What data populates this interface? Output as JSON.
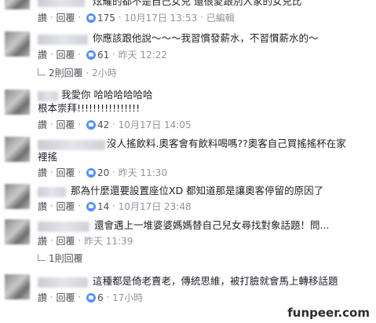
{
  "comments": [
    {
      "text": "炫耀的都不是自己女兒 還很愛跟別人家的女兒比",
      "like_label": "讚",
      "reply_label": "回覆",
      "likes": "175",
      "time": "10月17日 13:53",
      "edited": "已編輯"
    },
    {
      "text": "你應該跟他說～～～我習慣發薪水，不習慣薪水的～",
      "like_label": "讚",
      "reply_label": "回覆",
      "likes": "61",
      "time": "昨天 12:22",
      "replies": "2則回覆",
      "replies_time": "2小時"
    },
    {
      "text": "我愛你 哈哈哈哈哈哈",
      "text2": "根本崇拜!!!!!!!!!!!!!!!!",
      "like_label": "讚",
      "reply_label": "回覆",
      "likes": "42",
      "time": "10月17日 14:05"
    },
    {
      "text": "沒人搖飲料.奧客會有飲料喝嗎??奧客自己買搖搖杯在家",
      "text2": "裡搖",
      "like_label": "讚",
      "reply_label": "回覆",
      "likes": "20",
      "time": "昨天 11:30"
    },
    {
      "text": "那為什麼還要設置座位XD 都知道那是讓奧客停留的原因了",
      "like_label": "讚",
      "reply_label": "回覆",
      "likes": "14",
      "time": "10月17日 23:48"
    },
    {
      "text": "還會遇上一堆婆婆媽媽替自己兒女尋找對象話題！問...",
      "like_label": "讚",
      "reply_label": "回覆",
      "time": "昨天 11:39",
      "replies": "1則回覆"
    },
    {
      "text": "這種都是倚老賣老，傳統思維，被打臉就會馬上轉移話題",
      "like_label": "讚",
      "reply_label": "回覆",
      "likes": "6",
      "time": "17小時"
    }
  ],
  "watermark": "funpeer.com",
  "icons": {
    "like": "like-thumb-icon",
    "reply": "reply-arrow-icon"
  },
  "colors": {
    "link": "#4b4f56",
    "meta": "#90949c",
    "like_badge": "#5890ff"
  }
}
